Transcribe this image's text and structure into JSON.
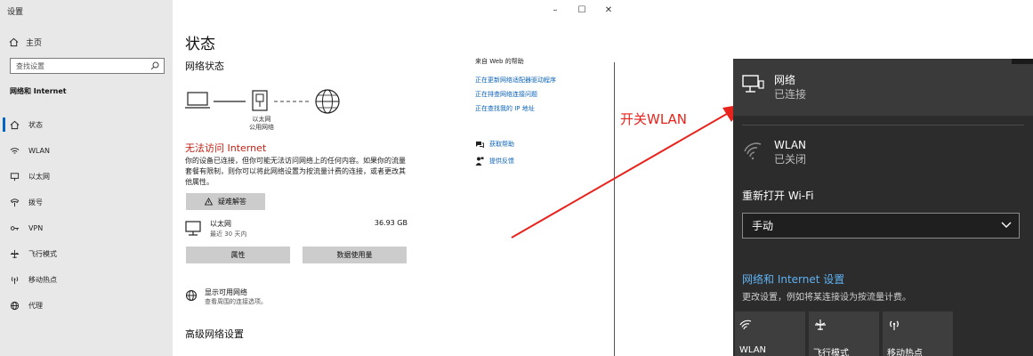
{
  "settings": {
    "window_title": "设置",
    "home_label": "主页",
    "search_placeholder": "查找设置",
    "section_title": "网络和 Internet",
    "nav": [
      {
        "label": "状态",
        "icon": "home-status-icon"
      },
      {
        "label": "WLAN",
        "icon": "wifi-icon"
      },
      {
        "label": "以太网",
        "icon": "ethernet-icon"
      },
      {
        "label": "拨号",
        "icon": "dialup-icon"
      },
      {
        "label": "VPN",
        "icon": "vpn-icon"
      },
      {
        "label": "飞行模式",
        "icon": "airplane-icon"
      },
      {
        "label": "移动热点",
        "icon": "hotspot-icon"
      },
      {
        "label": "代理",
        "icon": "globe-icon"
      }
    ],
    "controls": {
      "minimize": "–",
      "maximize": "☐",
      "close": "✕"
    }
  },
  "main": {
    "page_title": "状态",
    "network_status_heading": "网络状态",
    "diagram_label_1": "以太网",
    "diagram_label_2": "公用网络",
    "error_title": "无法访问 Internet",
    "error_desc": "你的设备已连接，但你可能无法访问网络上的任何内容。如果你的流量套餐有限制，则你可以将此网络设置为按流量计费的连接，或者更改其他属性。",
    "troubleshoot_label": "疑难解答",
    "ethernet": {
      "name": "以太网",
      "sub": "最近 30 天内",
      "size": "36.93 GB"
    },
    "properties_label": "属性",
    "data_usage_label": "数据使用量",
    "available": {
      "name": "显示可用网络",
      "sub": "查看周围的连接选项。"
    },
    "advanced_heading": "高级网络设置"
  },
  "help": {
    "title": "来自 Web 的帮助",
    "links": [
      "正在更新网络适配器驱动程序",
      "正在排查网络连接问题",
      "正在查找我的 IP 地址"
    ],
    "get_help": "获取帮助",
    "feedback": "提供反馈"
  },
  "annotation": {
    "text": "开关WLAN",
    "color": "#e8231c"
  },
  "flyout": {
    "network": {
      "name": "网络",
      "status": "已连接"
    },
    "wlan": {
      "name": "WLAN",
      "status": "已关闭"
    },
    "reopen_label": "重新打开 Wi-Fi",
    "dropdown_value": "手动",
    "settings_link": "网络和 Internet 设置",
    "settings_sub": "更改设置，例如将某连接设为按流量计费。",
    "tiles": [
      "WLAN",
      "飞行模式",
      "移动热点"
    ]
  },
  "colors": {
    "accent": "#0067c0",
    "error": "#c21e12",
    "link": "#0b63b8",
    "flyout_bg": "#2c2c2c",
    "flyout_link": "#5fb2f2"
  }
}
